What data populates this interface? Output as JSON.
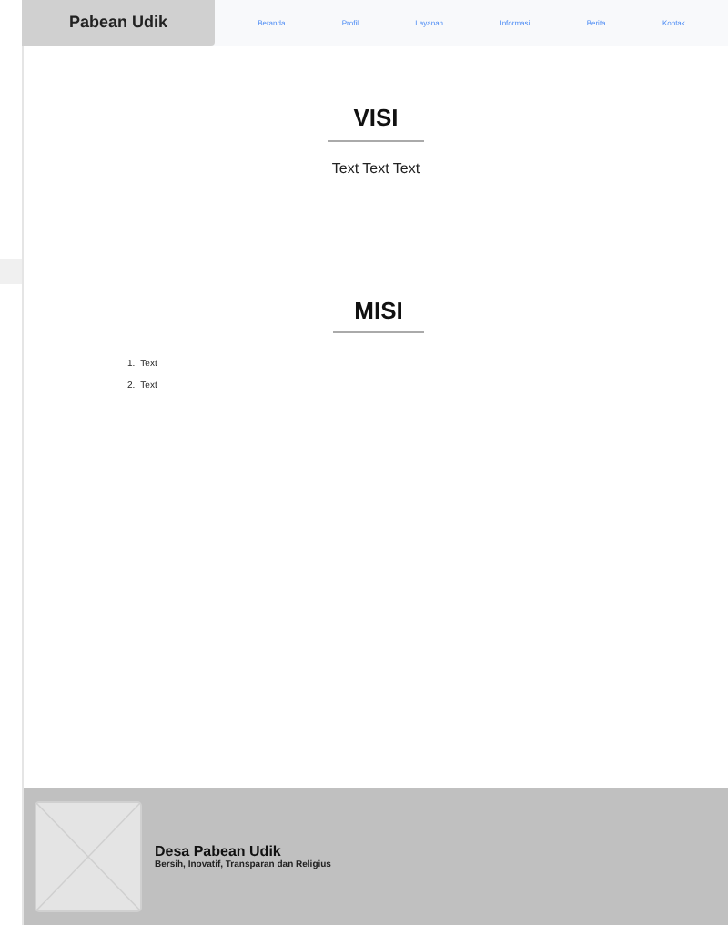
{
  "header": {
    "brand": "Pabean Udik",
    "nav": [
      {
        "label": "Beranda"
      },
      {
        "label": "Profil"
      },
      {
        "label": "Layanan"
      },
      {
        "label": "Informasi"
      },
      {
        "label": "Berita"
      },
      {
        "label": "Kontak"
      }
    ]
  },
  "visi": {
    "title": "VISI",
    "text": "Text Text Text"
  },
  "misi": {
    "title": "MISI",
    "items": [
      {
        "number": "1.",
        "text": "Text"
      },
      {
        "number": "2.",
        "text": "Text"
      }
    ]
  },
  "footer": {
    "title": "Desa Pabean Udik",
    "tagline": "Bersih, Inovatif, Transparan dan Religius"
  }
}
